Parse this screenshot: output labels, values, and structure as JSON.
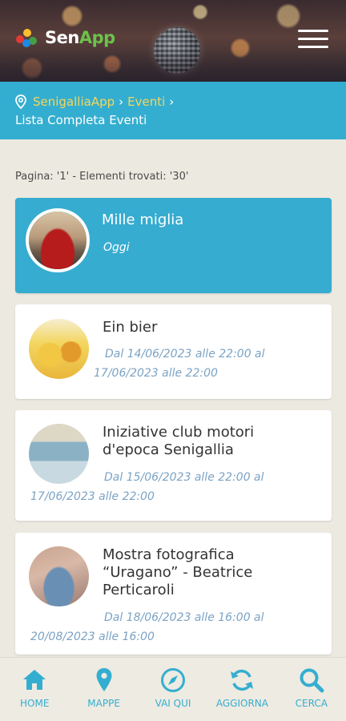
{
  "header": {
    "logo_main": "Sen",
    "logo_accent": "App"
  },
  "breadcrumb": {
    "items": [
      "SenigalliaApp",
      "Eventi"
    ],
    "separator": "›",
    "current": "Lista Completa Eventi"
  },
  "page_info": "Pagina: '1' - Elementi trovati: '30'",
  "events": [
    {
      "title": "Mille miglia",
      "date": "Oggi"
    },
    {
      "title": "Ein bier",
      "date": "Dal 14/06/2023 alle 22:00 al 17/06/2023 alle 22:00"
    },
    {
      "title_line1": "Iniziative club motori",
      "title_line2": "d'epoca Senigallia",
      "date": "Dal 15/06/2023 alle 22:00 al 17/06/2023 alle 22:00"
    },
    {
      "title_line1": "Mostra fotografica",
      "title_line2": "“Uragano” - Beatrice",
      "title_line3": "Perticaroli",
      "date": "Dal 18/06/2023 alle 16:00 al 20/08/2023 alle 16:00"
    }
  ],
  "nav": [
    {
      "label": "HOME",
      "icon": "home-icon"
    },
    {
      "label": "MAPPE",
      "icon": "map-marker-icon"
    },
    {
      "label": "VAI QUI",
      "icon": "compass-icon"
    },
    {
      "label": "AGGIORNA",
      "icon": "refresh-icon"
    },
    {
      "label": "CERCA",
      "icon": "search-icon"
    }
  ],
  "colors": {
    "accent": "#34aed0",
    "breadcrumb_link": "#f7d558",
    "date_text": "#7ba3c4",
    "background": "#ece9e0"
  }
}
